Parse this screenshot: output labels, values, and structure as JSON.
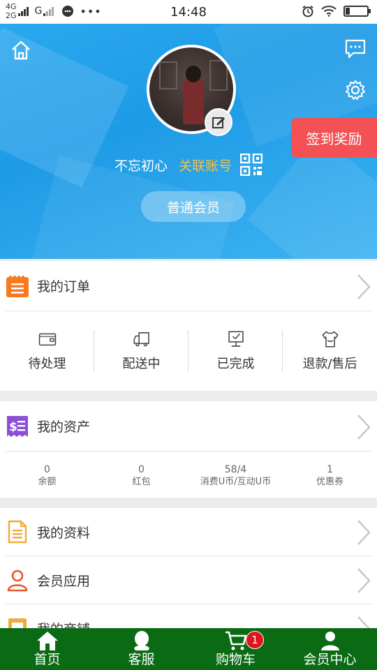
{
  "status_bar": {
    "net1": "4G",
    "net2": "2G",
    "net3": "G",
    "time": "14:48",
    "battery_level_fraction": 0.2
  },
  "header": {
    "nickname": "不忘初心",
    "link_account": "关联账号",
    "member_level": "普通会员",
    "signin_reward": "签到奖励"
  },
  "orders": {
    "title": "我的订单",
    "items": [
      {
        "label": "待处理"
      },
      {
        "label": "配送中"
      },
      {
        "label": "已完成"
      },
      {
        "label": "退款/售后"
      }
    ]
  },
  "assets": {
    "title": "我的资产",
    "items": [
      {
        "value": "0",
        "label": "余额"
      },
      {
        "value": "0",
        "label": "红包"
      },
      {
        "value": "58/4",
        "label": "消费U币/互动U币"
      },
      {
        "value": "1",
        "label": "优惠券"
      }
    ]
  },
  "menu": {
    "profile": "我的资料",
    "member_apps": "会员应用",
    "my_shop": "我的商铺"
  },
  "bottom_nav": {
    "items": [
      {
        "label": "首页"
      },
      {
        "label": "客服"
      },
      {
        "label": "购物车"
      },
      {
        "label": "会员中心"
      }
    ],
    "cart_badge": "1"
  },
  "colors": {
    "header_blue": "#1e9be6",
    "accent_gold": "#f5c242",
    "signin_red": "#f35153",
    "nav_green": "#0a6b14",
    "order_orange": "#f77b1e",
    "asset_purple": "#8c4fd6"
  }
}
